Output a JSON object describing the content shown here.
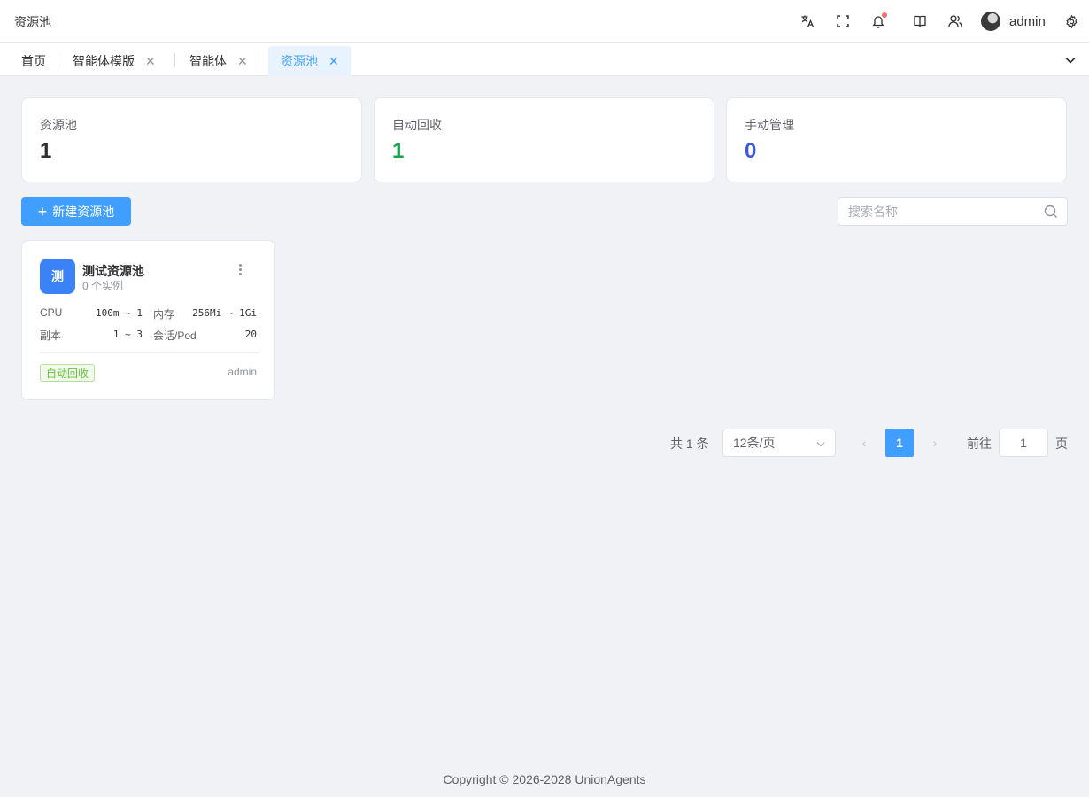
{
  "header": {
    "title": "资源池",
    "user_name": "admin"
  },
  "tabs": [
    {
      "label": "首页"
    },
    {
      "label": "智能体模版"
    },
    {
      "label": "智能体"
    },
    {
      "label": "资源池"
    }
  ],
  "stats": [
    {
      "label": "资源池",
      "value": "1",
      "color": "#303133"
    },
    {
      "label": "自动回收",
      "value": "1",
      "color": "#16a34a"
    },
    {
      "label": "手动管理",
      "value": "0",
      "color": "#3b5bdb"
    }
  ],
  "toolbar": {
    "create_label": "新建资源池",
    "search_placeholder": "搜索名称"
  },
  "pool_card": {
    "initial": "测",
    "name": "测试资源池",
    "instances": "0 个实例",
    "cpu_label": "CPU",
    "cpu_value": "100m ~ 1",
    "memory_label": "内存",
    "memory_value": "256Mi ~ 1Gi",
    "replicas_label": "副本",
    "replicas_value": "1 ~ 3",
    "sessions_label": "会话/Pod",
    "sessions_value": "20",
    "tag": "自动回收",
    "owner": "admin"
  },
  "pagination": {
    "total": "共 1 条",
    "page_size": "12条/页",
    "current_page": "1",
    "goto_label": "前往",
    "goto_value": "1",
    "page_suffix": "页"
  },
  "footer": "Copyright © 2026-2028 UnionAgents"
}
